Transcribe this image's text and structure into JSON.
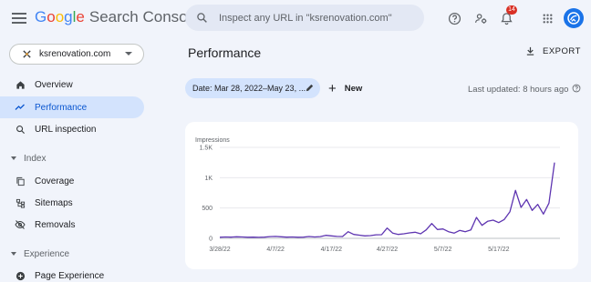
{
  "app": {
    "brand_letters": [
      "G",
      "o",
      "o",
      "g",
      "l",
      "e"
    ],
    "product": "Search Console",
    "search_placeholder": "Inspect any URL in \"ksrenovation.com\"",
    "notification_count": "14",
    "icons": [
      "menu-icon",
      "search-icon",
      "help-icon",
      "account-settings-icon",
      "bell-icon",
      "apps-icon",
      "avatar-icon"
    ]
  },
  "sidebar": {
    "property": "ksrenovation.com",
    "items": [
      {
        "label": "Overview",
        "icon": "home-icon"
      },
      {
        "label": "Performance",
        "icon": "trending-icon",
        "active": true
      },
      {
        "label": "URL inspection",
        "icon": "search-icon"
      }
    ],
    "sections": [
      {
        "label": "Index",
        "items": [
          {
            "label": "Coverage",
            "icon": "copy-icon"
          },
          {
            "label": "Sitemaps",
            "icon": "sitemap-icon"
          },
          {
            "label": "Removals",
            "icon": "visibility-off-icon"
          }
        ]
      },
      {
        "label": "Experience",
        "items": [
          {
            "label": "Page Experience",
            "icon": "plus-circle-icon"
          }
        ]
      }
    ]
  },
  "main": {
    "title": "Performance",
    "export_label": "EXPORT",
    "date_filter": "Date: Mar 28, 2022–May 23, ...",
    "new_label": "New",
    "last_updated": "Last updated: 8 hours ago"
  },
  "chart_data": {
    "type": "line",
    "title": "",
    "ylabel": "Impressions",
    "xlabel": "",
    "ylim": [
      0,
      1500
    ],
    "y_ticks": [
      "1.5K",
      "1K",
      "500",
      "0"
    ],
    "y_tick_values": [
      1500,
      1000,
      500,
      0
    ],
    "x_ticks": [
      "3/28/22",
      "4/7/22",
      "4/17/22",
      "4/27/22",
      "5/7/22",
      "5/17/22"
    ],
    "x_tick_day_index": [
      0,
      10,
      20,
      30,
      40,
      50
    ],
    "grid": true,
    "series_color": "#5e35b1",
    "series": [
      {
        "name": "Impressions",
        "values": [
          18,
          22,
          20,
          25,
          22,
          18,
          20,
          16,
          20,
          28,
          32,
          25,
          20,
          22,
          18,
          20,
          30,
          22,
          28,
          50,
          40,
          32,
          30,
          110,
          65,
          52,
          40,
          45,
          58,
          60,
          170,
          85,
          65,
          75,
          90,
          100,
          75,
          140,
          245,
          145,
          155,
          110,
          85,
          130,
          110,
          140,
          345,
          215,
          280,
          300,
          260,
          310,
          440,
          790,
          510,
          640,
          460,
          560,
          400,
          580,
          1250
        ]
      }
    ]
  }
}
